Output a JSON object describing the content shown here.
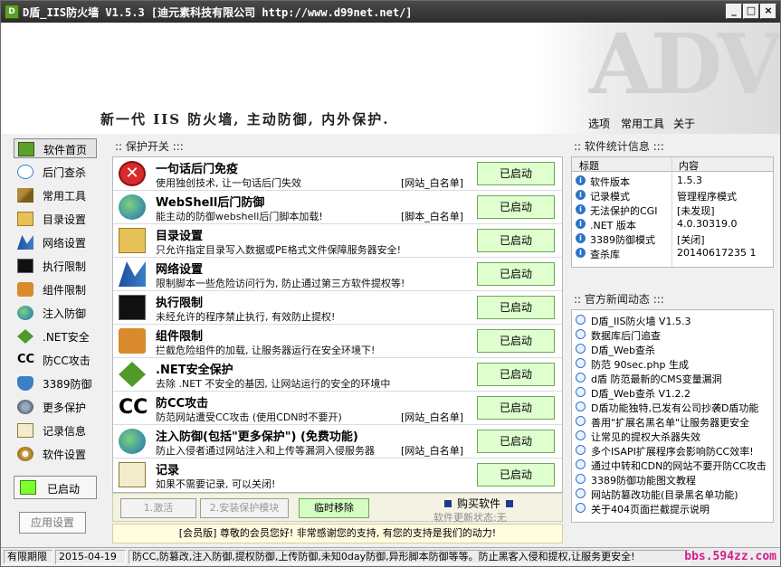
{
  "window": {
    "title": "D盾_IIS防火墙 V1.5.3 [迪元素科技有限公司 http://www.d99net.net/]",
    "app_icon_glyph": "D",
    "minimize": "_",
    "maximize": "□",
    "close": "×"
  },
  "banner": {
    "slogan": "新一代 IIS 防火墙, 主动防御, 内外保护.",
    "watermark": "ADV",
    "menu": [
      "选项",
      "常用工具",
      "关于"
    ]
  },
  "sidebar": {
    "items": [
      {
        "label": "软件首页",
        "icon": "home-icon"
      },
      {
        "label": "后门查杀",
        "icon": "eye-icon"
      },
      {
        "label": "常用工具",
        "icon": "tool-icon"
      },
      {
        "label": "目录设置",
        "icon": "folder-icon"
      },
      {
        "label": "网络设置",
        "icon": "network-icon"
      },
      {
        "label": "执行限制",
        "icon": "console-icon"
      },
      {
        "label": "组件限制",
        "icon": "component-icon"
      },
      {
        "label": "注入防御",
        "icon": "globe-icon"
      },
      {
        "label": ".NET安全",
        "icon": "dotnet-icon"
      },
      {
        "label": "防CC攻击",
        "icon": "cc-icon"
      },
      {
        "label": "3389防御",
        "icon": "shield-icon"
      },
      {
        "label": "更多保护",
        "icon": "more-icon"
      },
      {
        "label": "记录信息",
        "icon": "log-icon"
      },
      {
        "label": "软件设置",
        "icon": "settings-icon"
      }
    ],
    "status_label": "已启动",
    "apply_button": "应用设置"
  },
  "protect": {
    "header": ":: 保护开关 :::",
    "rows": [
      {
        "title": "一句话后门免疫",
        "desc": "使用独创技术, 让一句话后门失效",
        "tag": "[网站_白名单]",
        "button": "已启动",
        "icon": "block-icon"
      },
      {
        "title": "WebShell后门防御",
        "desc": "能主动的防御webshell后门脚本加载!",
        "tag": "[脚本_白名单]",
        "button": "已启动",
        "icon": "globe-icon"
      },
      {
        "title": "目录设置",
        "desc": "只允许指定目录写入数据或PE格式文件保障服务器安全!",
        "tag": "",
        "button": "已启动",
        "icon": "folder-icon"
      },
      {
        "title": "网络设置",
        "desc": "限制脚本一些危险访问行为, 防止通过第三方软件提权等!",
        "tag": "",
        "button": "已启动",
        "icon": "network-icon"
      },
      {
        "title": "执行限制",
        "desc": "未经允许的程序禁止执行, 有效防止提权!",
        "tag": "",
        "button": "已启动",
        "icon": "console-icon"
      },
      {
        "title": "组件限制",
        "desc": "拦截危险组件的加载, 让服务器运行在安全环境下!",
        "tag": "",
        "button": "已启动",
        "icon": "component-icon"
      },
      {
        "title": ".NET安全保护",
        "desc": "去除 .NET 不安全的基因, 让网站运行的安全的环境中",
        "tag": "",
        "button": "已启动",
        "icon": "dotnet-icon"
      },
      {
        "title": "防CC攻击",
        "desc": "防范网站遭受CC攻击 (使用CDN时不要开)",
        "tag": "[网站_白名单]",
        "button": "已启动",
        "icon": "cc-icon"
      },
      {
        "title": "注入防御(包括\"更多保护\") (免费功能)",
        "desc": "防止入侵者通过网站注入和上传等漏洞入侵服务器",
        "tag": "[网站_白名单]",
        "button": "已启动",
        "icon": "globe-icon"
      },
      {
        "title": "记录",
        "desc": "如果不需要记录, 可以关闭!",
        "tag": "",
        "button": "已启动",
        "icon": "log-icon"
      }
    ],
    "bottom": {
      "activate": "1.激活",
      "install": "2.安装保护模块",
      "temp_remove": "临时移除",
      "buy": "购买软件",
      "update_status": "软件更新状态:无"
    },
    "notice": "[会员版] 尊敬的会员您好! 非常感谢您的支持, 有您的支持是我们的动力!"
  },
  "stats": {
    "header": ":: 软件统计信息 :::",
    "col_title": "标题",
    "col_content": "内容",
    "rows": [
      {
        "k": "软件版本",
        "v": "1.5.3"
      },
      {
        "k": "记录模式",
        "v": "管理程序模式"
      },
      {
        "k": "无法保护的CGI",
        "v": "[未发现]"
      },
      {
        "k": ".NET 版本",
        "v": "4.0.30319.0"
      },
      {
        "k": "3389防御模式",
        "v": "[关闭]"
      },
      {
        "k": "查杀库",
        "v": "20140617235 1"
      }
    ]
  },
  "news": {
    "header": ":: 官方新闻动态 :::",
    "items": [
      "D盾_IIS防火墙 V1.5.3",
      "数据库后门追查",
      "D盾_Web查杀",
      "防范 90sec.php 生成",
      "d盾 防范最新的CMS变量漏洞",
      "D盾_Web查杀 V1.2.2",
      "D盾功能独特,已发有公司抄袭D盾功能",
      "善用\"扩展名黑名单\"让服务器更安全",
      "让常见的提权大杀器失效",
      "多个ISAPI扩展程序会影响防CC效率!",
      "通过中转和CDN的网站不要开防CC攻击",
      "3389防御功能图文教程",
      "网站防篡改功能(目录黑名单功能)",
      "关于404页面拦截提示说明"
    ]
  },
  "statusbar": {
    "license": "有限期限",
    "date": "2015-04-19",
    "message": "防CC,防篡改,注入防御,提权防御,上传防御,未知0day防御,异形脚本防御等等。防止黑客入侵和提权,让服务更安全!",
    "site": "bbs.594zz.com"
  },
  "colors": {
    "button_on": "#dfffcf",
    "led": "#7cff2c",
    "link_pink": "#d0208a"
  }
}
